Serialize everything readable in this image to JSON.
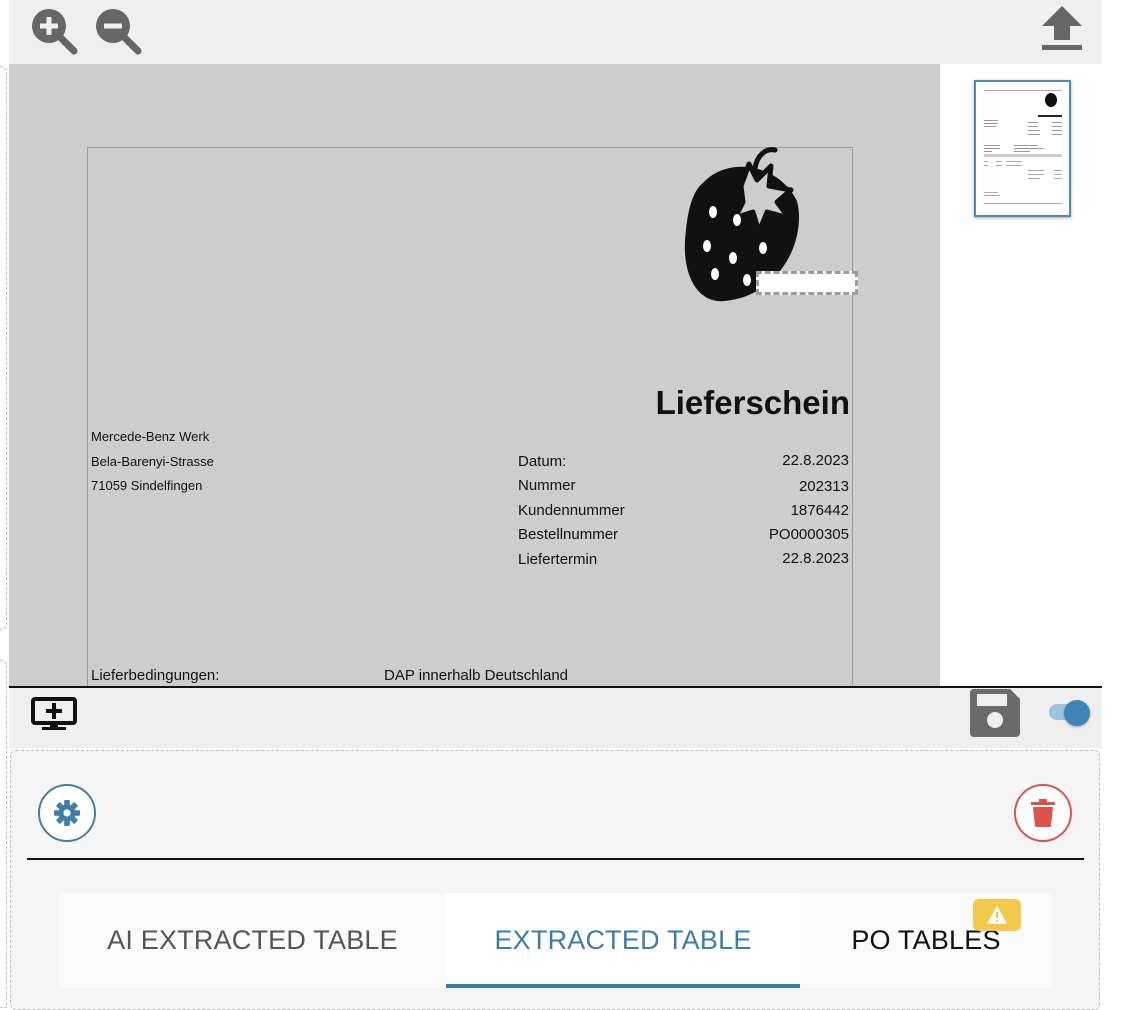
{
  "toolbar": {
    "zoom_in_icon": "zoom-in-icon",
    "zoom_out_icon": "zoom-out-icon",
    "upload_icon": "upload-icon"
  },
  "document": {
    "title": "Lieferschein",
    "address": {
      "line1": "Mercede-Benz Werk",
      "line2": "Bela-Barenyi-Strasse",
      "line3": "71059 Sindelfingen"
    },
    "fields": [
      {
        "label": "Datum:",
        "value": "22.8.2023"
      },
      {
        "label": "Nummer",
        "value": "202313"
      },
      {
        "label": "Kundennummer",
        "value": "1876442"
      },
      {
        "label": "Bestellnummer",
        "value": "PO0000305"
      },
      {
        "label": "Liefertermin",
        "value": "22.8.2023"
      }
    ],
    "delivery_terms_label": "Lieferbedingungen:",
    "delivery_terms_value": "DAP innerhalb Deutschland"
  },
  "tabs": [
    {
      "label": "AI EXTRACTED TABLE",
      "active": false
    },
    {
      "label": "EXTRACTED TABLE",
      "active": true
    },
    {
      "label": "PO TABLES",
      "active": false,
      "warning": true
    }
  ],
  "colors": {
    "accent": "#3a7ea8",
    "danger": "#d9534f",
    "warning": "#f2c94c",
    "viewer_bg": "#cdcdcd"
  }
}
